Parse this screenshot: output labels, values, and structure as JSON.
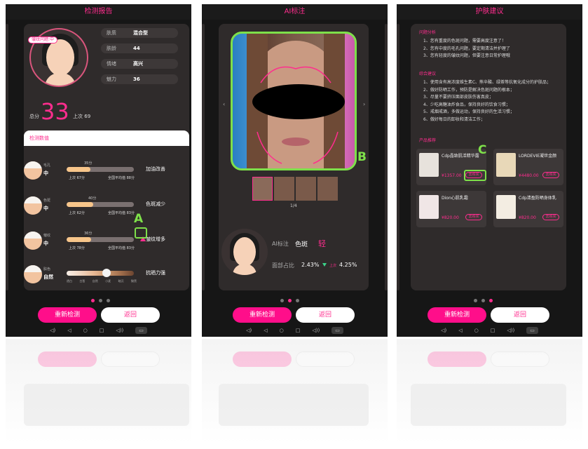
{
  "screen1": {
    "title": "检测报告",
    "bubble": "皱纹问题:中",
    "stats": [
      {
        "key": "肤质",
        "value": "混合型"
      },
      {
        "key": "肤龄",
        "value": "44"
      },
      {
        "key": "情绪",
        "value": "高兴"
      },
      {
        "key": "魅力",
        "value": "36"
      }
    ],
    "total_label": "总分",
    "total_score": "33",
    "last_label": "上次",
    "last_score": "69",
    "tab_label": "检测数值",
    "metrics": [
      {
        "name": "毛孔",
        "level": "中",
        "score": "35分",
        "score_value": 35,
        "last": "上次 67分",
        "avg": "全国平均值 88分",
        "trend": "加油改善"
      },
      {
        "name": "色斑",
        "level": "中",
        "score": "40分",
        "score_value": 40,
        "last": "上次 62分",
        "avg": "全国平均值 83分",
        "trend": "色斑减少"
      },
      {
        "name": "皱纹",
        "level": "中",
        "score": "36分",
        "score_value": 36,
        "last": "上次 78分",
        "avg": "全国平均值 83分",
        "trend": "皱纹增多"
      },
      {
        "name": "肤色",
        "level": "自然",
        "trend": "抗晒力强"
      }
    ],
    "skin_tone_labels": [
      "透白",
      "白皙",
      "自然",
      "小麦",
      "暗沉",
      "黝黑"
    ]
  },
  "screen2": {
    "title": "AI标注",
    "pager": "1/4",
    "ai_label": "AI标注",
    "ai_type": "色斑",
    "ai_level": "轻",
    "ratio_label": "面部占比",
    "ratio_value": "2.43%",
    "last_label": "上次",
    "last_value": "4.25%"
  },
  "screen3": {
    "title": "护肤建议",
    "problems_title": "问题分析",
    "problems": [
      "1、您有重度的色斑问题，需要高度注意了！",
      "2、您有中度的毛孔问题，要定期清洁并护理了",
      "3、您有轻度的皱纹问题，但要注意日常护理哦"
    ],
    "advice_title": "综合建议",
    "advice": [
      "1、使用含有高浓度维生素C、熊辛酸、绿茶等抗氧化成分的护肤品；",
      "2、做好防晒工作，预防是解决色斑问题的根本；",
      "3、尽量不要挤压面部皮肤伤害真皮；",
      "4、少吃高糖油炸食品，保持良好的饮食习惯；",
      "5、戒烟戒酒，多做运动，保持良好的生活习惯；",
      "6、做好每日的卸妆和清洁工作；"
    ],
    "products_title": "产品推荐",
    "products": [
      {
        "name": "Cdp晶致肌活精华露",
        "price": "¥1357.00",
        "buy": "去购买"
      },
      {
        "name": "LORDEVIE凝世金颜",
        "price": "¥4480.00",
        "buy": "去购买"
      },
      {
        "name": "Dion心肌乳霜",
        "price": "¥820.00",
        "buy": "去购买"
      },
      {
        "name": "Cdp清盈防晒身体乳",
        "price": "¥820.00",
        "buy": "去购买"
      }
    ]
  },
  "buttons": {
    "retest": "重新检测",
    "back": "返回"
  },
  "annotations": {
    "a": "A",
    "b": "B",
    "c": "C"
  },
  "colors": {
    "accent": "#ff2d8e",
    "annotation": "#7ee04a",
    "panel": "#2f2b2b",
    "background": "#161616"
  }
}
